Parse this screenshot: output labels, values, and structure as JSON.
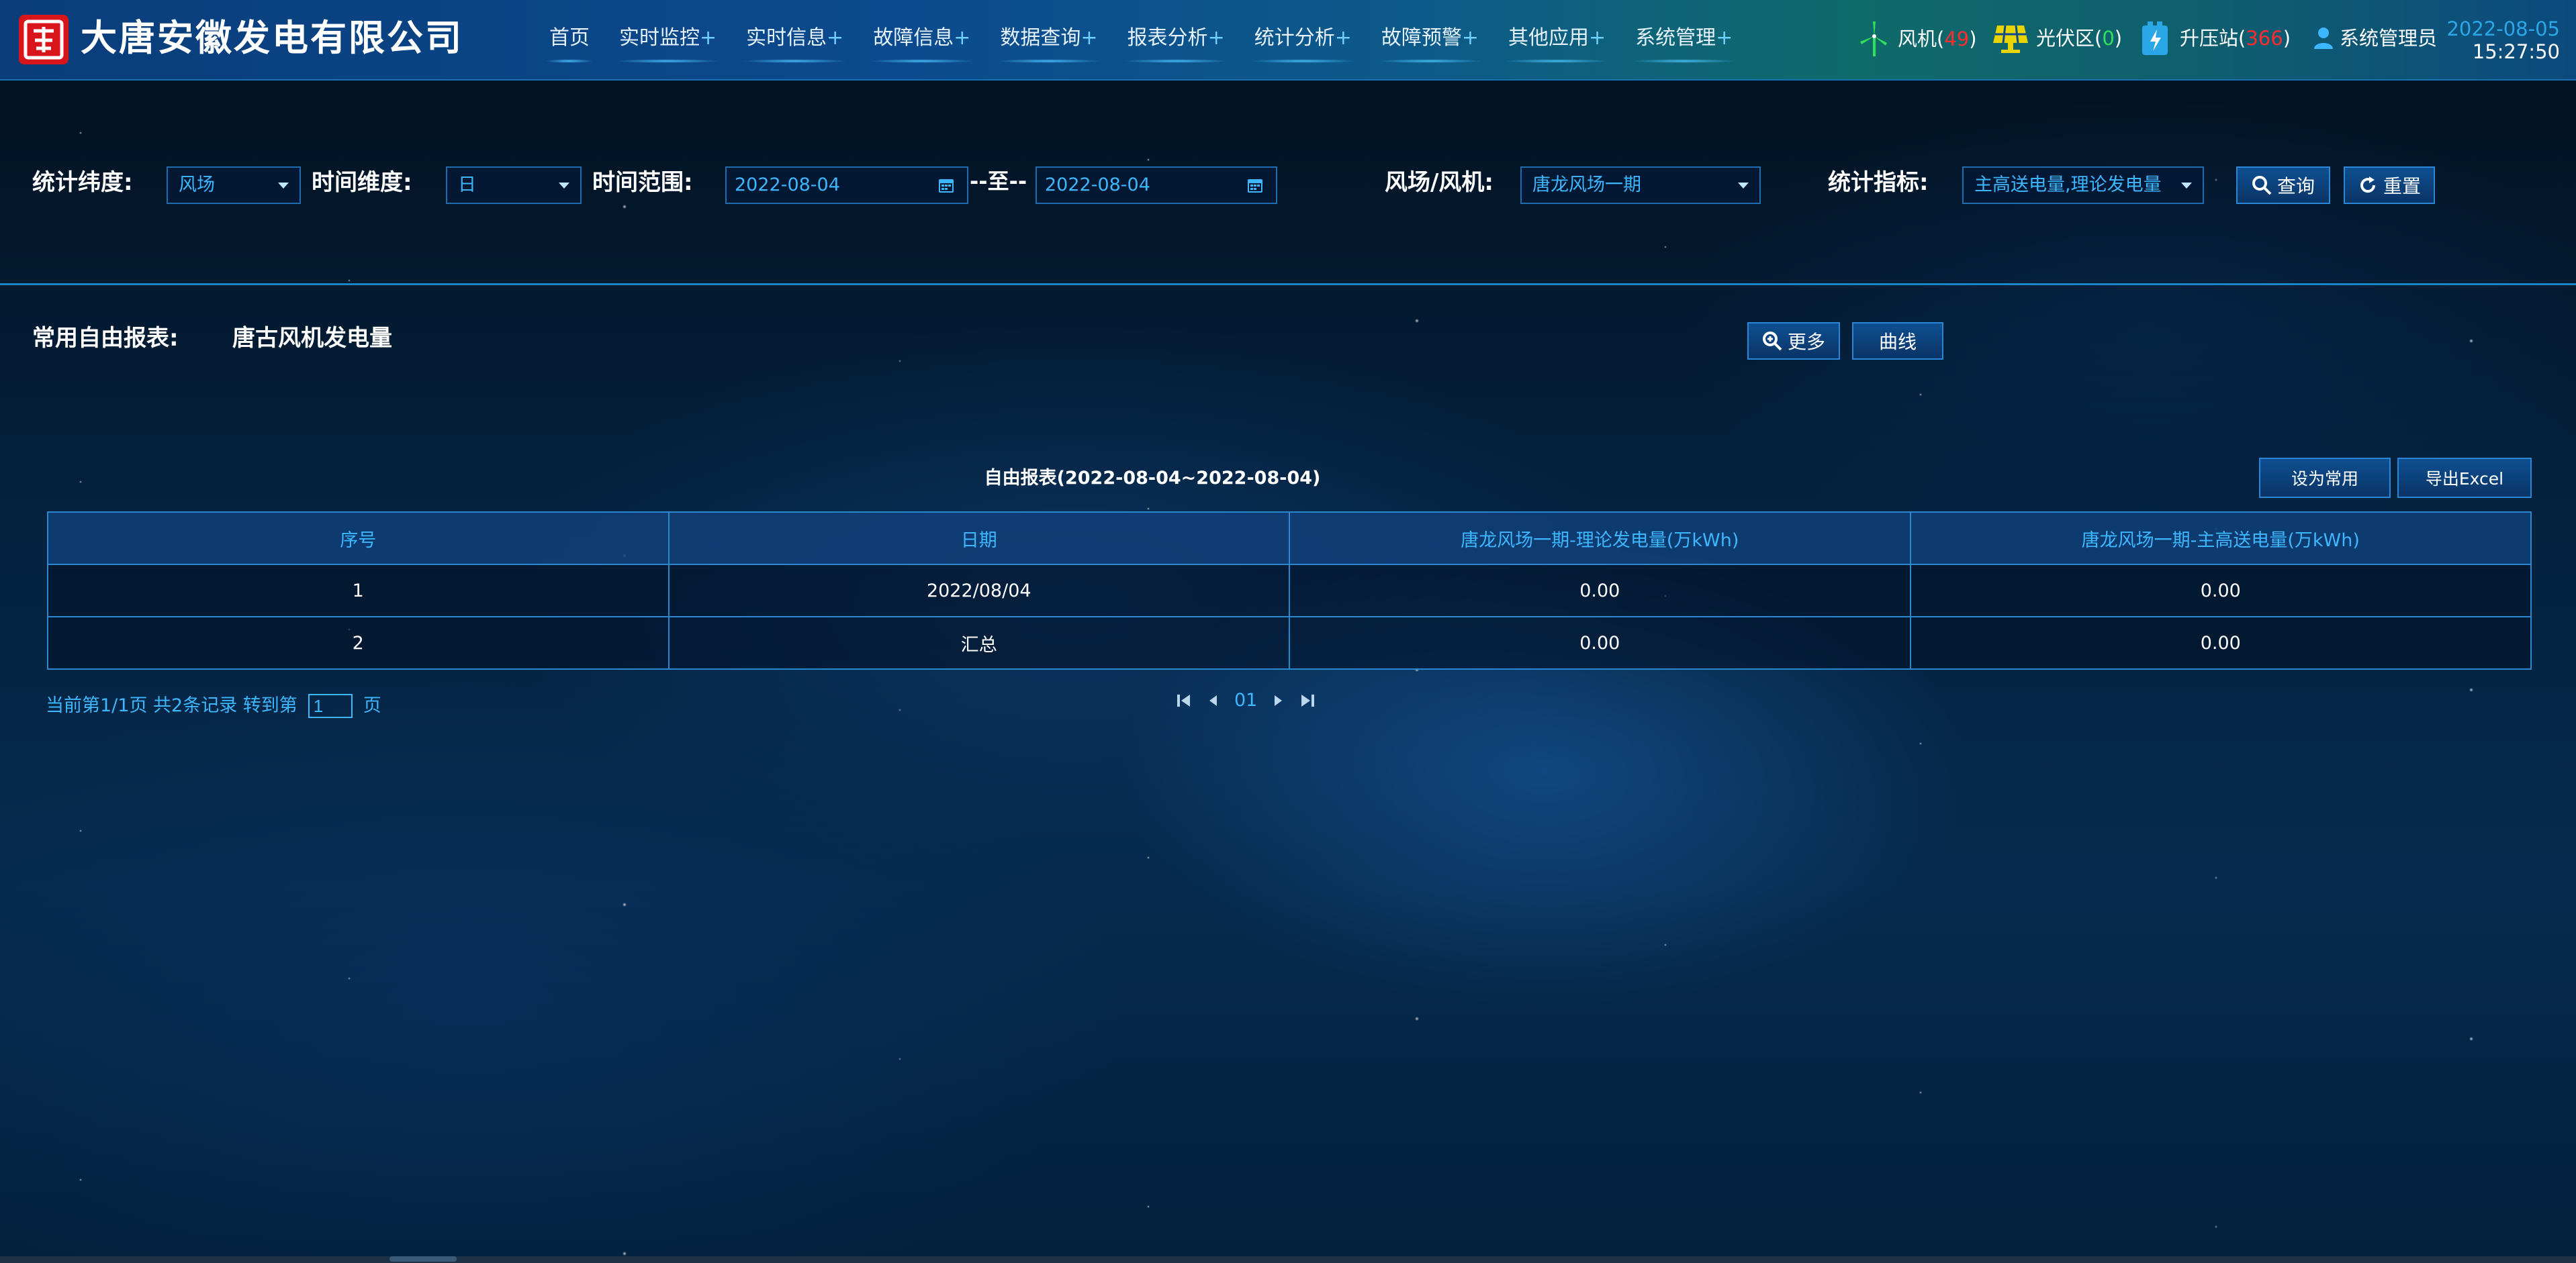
{
  "header": {
    "company": "大唐安徽发电有限公司",
    "nav": [
      {
        "label": "首页",
        "plus": ""
      },
      {
        "label": "实时监控",
        "plus": "+"
      },
      {
        "label": "实时信息",
        "plus": "+"
      },
      {
        "label": "故障信息",
        "plus": "+"
      },
      {
        "label": "数据查询",
        "plus": "+"
      },
      {
        "label": "报表分析",
        "plus": "+"
      },
      {
        "label": "统计分析",
        "plus": "+"
      },
      {
        "label": "故障预警",
        "plus": "+"
      },
      {
        "label": "其他应用",
        "plus": "+"
      },
      {
        "label": "系统管理",
        "plus": "+"
      }
    ],
    "wind": {
      "label": "风机(",
      "count": "49",
      "close": ")"
    },
    "pv": {
      "label": "光伏区(",
      "count": "0",
      "close": ")"
    },
    "station": {
      "label": "升压站(",
      "count": "366",
      "close": ")"
    },
    "user": "系统管理员",
    "date": "2022-08-05",
    "time": "15:27:50"
  },
  "filters": {
    "stat_dim_label": "统计纬度:",
    "stat_dim_value": "风场",
    "time_dim_label": "时间维度:",
    "time_dim_value": "日",
    "range_label": "时间范围:",
    "range_start": "2022-08-04",
    "range_sep": "--至--",
    "range_end": "2022-08-04",
    "farm_label": "风场/风机:",
    "farm_value": "唐龙风场一期",
    "metric_label": "统计指标:",
    "metric_value": "主高送电量,理论发电量",
    "query_button": "查询",
    "reset_button": "重置"
  },
  "common_report": {
    "label": "常用自由报表:",
    "name": "唐古风机发电量",
    "more_button": "更多",
    "curve_button": "曲线"
  },
  "report": {
    "title": "自由报表(2022-08-04~2022-08-04)",
    "set_common_button": "设为常用",
    "export_button": "导出Excel",
    "columns": [
      "序号",
      "日期",
      "唐龙风场一期-理论发电量(万kWh)",
      "唐龙风场一期-主高送电量(万kWh)"
    ],
    "rows": [
      [
        "1",
        "2022/08/04",
        "0.00",
        "0.00"
      ],
      [
        "2",
        "汇总",
        "0.00",
        "0.00"
      ]
    ]
  },
  "pager": {
    "info": "当前第1/1页 共2条记录 转到第",
    "page_value": "1",
    "page_suffix": "页",
    "current": "01"
  },
  "colors": {
    "accent": "#3db7ff",
    "alarm": "#ff2d2d",
    "ok": "#2fe05a",
    "border": "#2a88d0"
  },
  "icons": [
    "logo-icon",
    "wind-turbine-icon",
    "solar-panel-icon",
    "substation-icon",
    "user-icon",
    "calendar-icon",
    "search-icon",
    "refresh-icon",
    "zoom-icon",
    "first-page-icon",
    "prev-page-icon",
    "next-page-icon",
    "last-page-icon"
  ]
}
